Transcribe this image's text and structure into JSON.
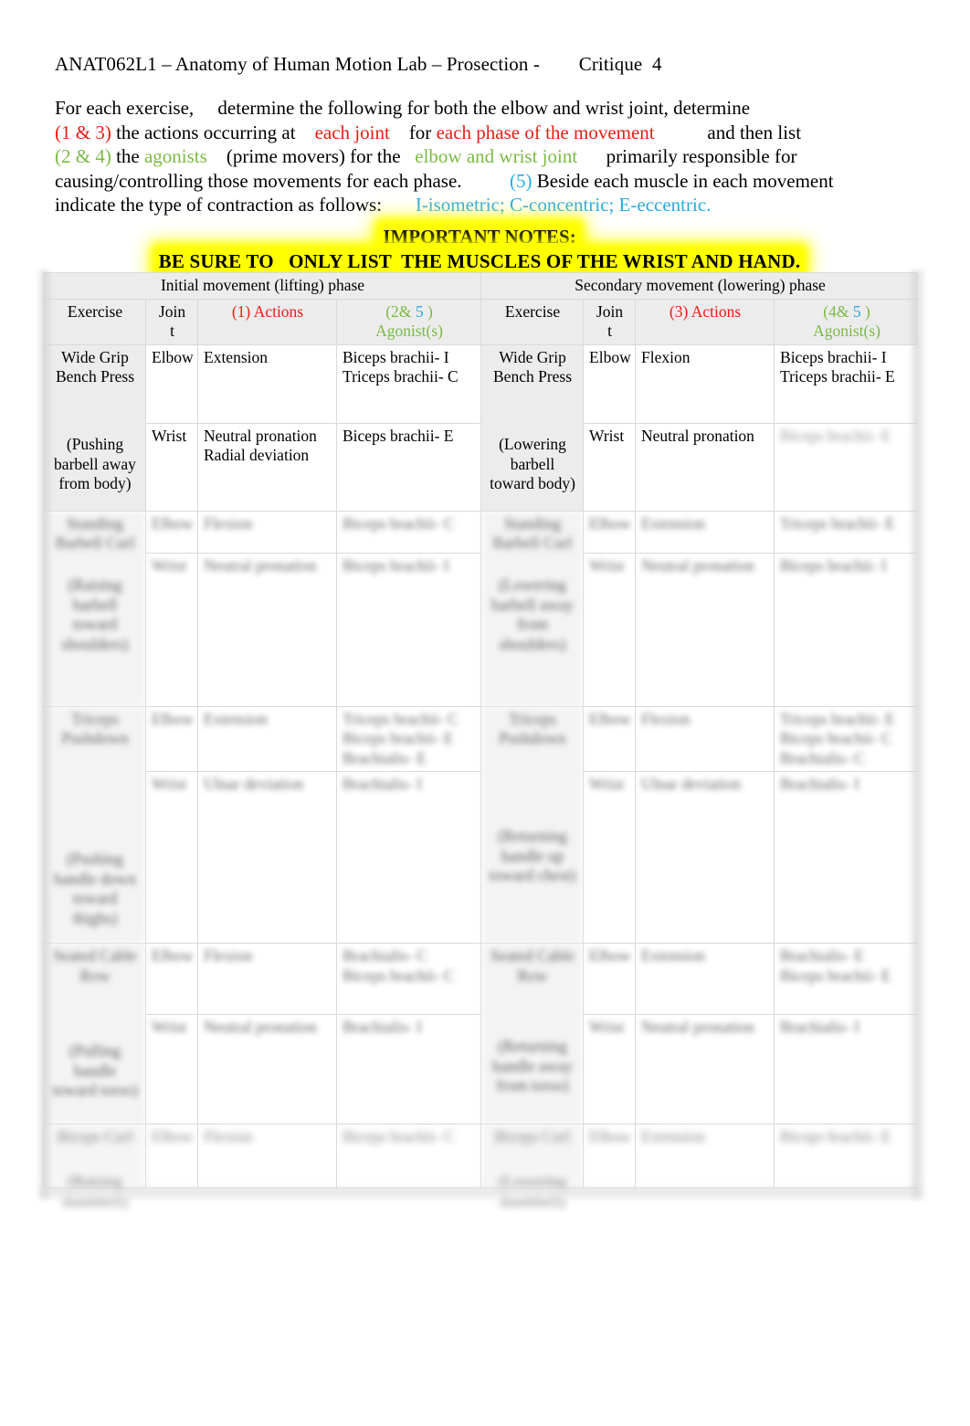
{
  "document": {
    "title": "ANAT062L1 – Anatomy of Human Motion Lab – Prosection -        Critique  4"
  },
  "instructions": {
    "line1": "For each exercise,     determine the following for both the elbow and wrist joint, determine",
    "line2_a": "(1 & 3)",
    "line2_b": " the actions occurring at ",
    "line2_c": "   each joint",
    "line2_d": "    for ",
    "line2_e": "each phase of the movement",
    "line2_f": "           and then list",
    "line3_a": "(2 & 4)",
    "line3_b": " the ",
    "line3_c": "agonists",
    "line3_d": "    (prime movers) for the ",
    "line3_e": "  elbow and wrist joint",
    "line3_f": "      primarily responsible for",
    "line4_a": "causing/controlling those movements for each phase.          ",
    "line4_b": "(5)",
    "line4_c": " Beside each muscle in each movement",
    "line5_a": "indicate the type of contraction as follows:       ",
    "line5_b": "I-isometric; C-concentric; E-eccentric."
  },
  "notes": {
    "heading": "IMPORTANT NOTES:",
    "body": "BE SURE TO   ONLY LIST  THE MUSCLES OF THE WRIST AND HAND."
  },
  "table": {
    "phase_headers": {
      "initial": "Initial movement (lifting) phase",
      "secondary": "Secondary movement (lowering) phase"
    },
    "column_headers": {
      "exercise": "Exercise",
      "joint_line1": "Join",
      "joint_line2": "t",
      "actions_initial_num": "(1)",
      "actions_initial_label": " Actions",
      "agonist_initial_num_a": "(2&",
      "agonist_initial_num_b": " 5",
      "agonist_initial_num_c": " )",
      "agonist_initial_label": "Agonist(s)",
      "actions_secondary_num": "(3)",
      "actions_secondary_label": " Actions",
      "agonist_secondary_num_a": "(4&",
      "agonist_secondary_num_b": " 5",
      "agonist_secondary_num_c": " )",
      "agonist_secondary_label": "Agonist(s)"
    },
    "rows": [
      {
        "legible": true,
        "left": {
          "exercise_name": "Wide Grip Bench Press",
          "exercise_note": "(Pushing barbell away from body)",
          "elbow": {
            "joint": "Elbow",
            "actions": "Extension",
            "agonists": "Biceps brachii- I\nTriceps brachii- C"
          },
          "wrist": {
            "joint": "Wrist",
            "actions": "Neutral pronation\nRadial deviation",
            "agonists": "Biceps brachii- E"
          }
        },
        "right": {
          "exercise_name": "Wide Grip Bench Press",
          "exercise_note": "(Lowering barbell toward body)",
          "elbow": {
            "joint": "Elbow",
            "actions": "Flexion",
            "agonists": "Biceps brachii- I\nTriceps brachii- E"
          },
          "wrist": {
            "joint": "Wrist",
            "actions": "Neutral pronation",
            "agonists": "Biceps brachii- E"
          }
        }
      },
      {
        "legible": false,
        "left": {
          "exercise_name": "Standing Barbell Curl",
          "exercise_note": "(Raising barbell toward shoulders)",
          "elbow": {
            "joint": "Elbow",
            "actions": "Flexion",
            "agonists": "Biceps brachii- C"
          },
          "wrist": {
            "joint": "Wrist",
            "actions": "Neutral pronation",
            "agonists": "Biceps brachii- I"
          }
        },
        "right": {
          "exercise_name": "Standing Barbell Curl",
          "exercise_note": "(Lowering barbell away from shoulders)",
          "elbow": {
            "joint": "Elbow",
            "actions": "Extension",
            "agonists": "Triceps brachii- E"
          },
          "wrist": {
            "joint": "Wrist",
            "actions": "Neutral pronation",
            "agonists": "Biceps brachii- I"
          }
        }
      },
      {
        "legible": false,
        "left": {
          "exercise_name": "Triceps Pushdown",
          "exercise_note": "(Pushing handle down toward thighs)",
          "elbow": {
            "joint": "Elbow",
            "actions": "Extension",
            "agonists": "Triceps brachii- C\nBiceps brachii- E\nBrachialis- E"
          },
          "wrist": {
            "joint": "Wrist",
            "actions": "Ulnar deviation",
            "agonists": "Brachialis- I"
          }
        },
        "right": {
          "exercise_name": "Triceps Pushdown",
          "exercise_note": "(Returning handle up toward chest)",
          "elbow": {
            "joint": "Elbow",
            "actions": "Flexion",
            "agonists": "Triceps brachii- E\nBiceps brachii- C\nBrachialis- C"
          },
          "wrist": {
            "joint": "Wrist",
            "actions": "Ulnar deviation",
            "agonists": "Brachialis- I"
          }
        }
      },
      {
        "legible": false,
        "left": {
          "exercise_name": "Seated Cable Row",
          "exercise_note": "(Pulling handle toward torso)",
          "elbow": {
            "joint": "Elbow",
            "actions": "Flexion",
            "agonists": "Brachialis- C\nBiceps brachii- C"
          },
          "wrist": {
            "joint": "Wrist",
            "actions": "Neutral pronation",
            "agonists": "Brachialis- I"
          }
        },
        "right": {
          "exercise_name": "Seated Cable Row",
          "exercise_note": "(Returning handle away from torso)",
          "elbow": {
            "joint": "Elbow",
            "actions": "Extension",
            "agonists": "Brachialis- E\nBiceps brachii- E"
          },
          "wrist": {
            "joint": "Wrist",
            "actions": "Neutral pronation",
            "agonists": "Brachialis- I"
          }
        }
      },
      {
        "legible": false,
        "left": {
          "exercise_name": "Biceps Curl",
          "exercise_note": "(Raising dumbbell)",
          "elbow": {
            "joint": "Elbow",
            "actions": "Flexion",
            "agonists": "Biceps brachii- C"
          },
          "wrist": {
            "joint": "Wrist",
            "actions": "",
            "agonists": ""
          }
        },
        "right": {
          "exercise_name": "Biceps Curl",
          "exercise_note": "(Lowering dumbbell)",
          "elbow": {
            "joint": "Elbow",
            "actions": "Extension",
            "agonists": "Biceps brachii- E"
          },
          "wrist": {
            "joint": "Wrist",
            "actions": "",
            "agonists": ""
          }
        }
      }
    ]
  },
  "colors": {
    "red": "#ed1b14",
    "green": "#7cba44",
    "cyan": "#29abe2",
    "highlight": "#ffff00",
    "shade": "#ececec",
    "border": "#d9d9d9"
  }
}
